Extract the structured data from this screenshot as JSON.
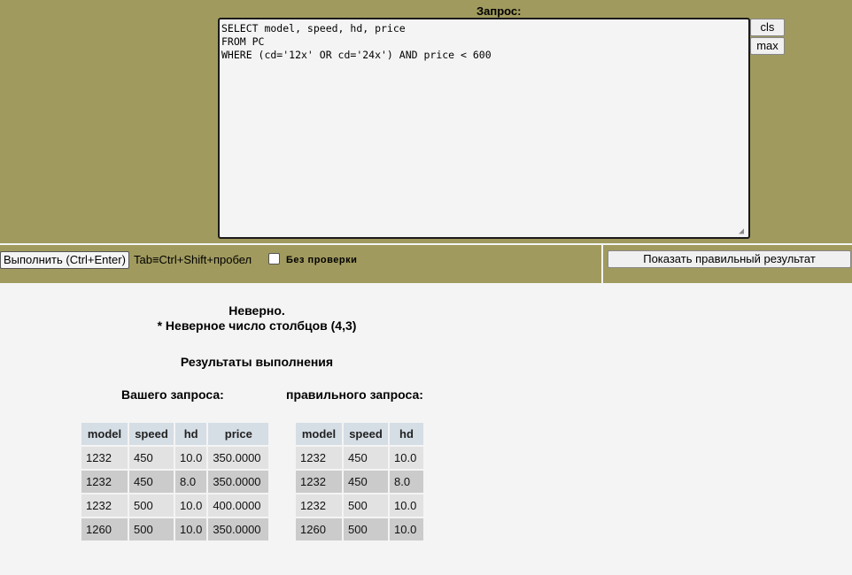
{
  "query": {
    "label": "Запрос:",
    "text": "SELECT model, speed, hd, price\nFROM PC\nWHERE (cd='12x' OR cd='24x') AND price < 600",
    "cls_label": "cls",
    "max_label": "max"
  },
  "toolbar": {
    "execute_label": "Выполнить (Ctrl+Enter)",
    "tab_hint": "Tab≡Ctrl+Shift+пробел",
    "no_check_label": "Без проверки",
    "no_check_checked": false,
    "show_correct_label": "Показать правильный результат"
  },
  "result": {
    "verdict": "Неверно.",
    "error": "* Неверное число столбцов (4,3)",
    "section_title": "Результаты выполнения",
    "your_query_label": "Вашего запроса:",
    "correct_query_label": "правильного запроса:"
  },
  "your_table": {
    "headers": [
      "model",
      "speed",
      "hd",
      "price"
    ],
    "rows": [
      [
        "1232",
        "450",
        "10.0",
        "350.0000"
      ],
      [
        "1232",
        "450",
        "8.0",
        "350.0000"
      ],
      [
        "1232",
        "500",
        "10.0",
        "400.0000"
      ],
      [
        "1260",
        "500",
        "10.0",
        "350.0000"
      ]
    ]
  },
  "correct_table": {
    "headers": [
      "model",
      "speed",
      "hd"
    ],
    "rows": [
      [
        "1232",
        "450",
        "10.0"
      ],
      [
        "1232",
        "450",
        "8.0"
      ],
      [
        "1232",
        "500",
        "10.0"
      ],
      [
        "1260",
        "500",
        "10.0"
      ]
    ]
  },
  "colors": {
    "panel_bg": "#a09a5e",
    "page_bg": "#f4f4f4",
    "header_cell": "#d5dde5",
    "row_light": "#e2e2e2",
    "row_dark": "#cbcbcb"
  }
}
